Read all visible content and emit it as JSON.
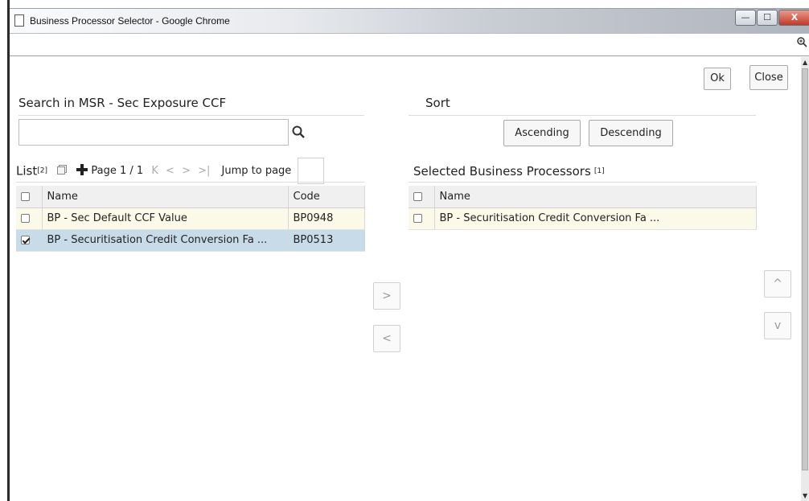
{
  "window": {
    "title": "Business Processor Selector - Google Chrome",
    "close_glyph": "X",
    "minimize_glyph": "—",
    "maximize_glyph": "☐"
  },
  "header_buttons": {
    "ok": "Ok",
    "close": "Close"
  },
  "search": {
    "label": "Search in MSR - Sec Exposure CCF",
    "value": "",
    "placeholder": ""
  },
  "sort": {
    "label": "Sort",
    "ascending": "Ascending",
    "descending": "Descending"
  },
  "list": {
    "label": "List",
    "count": "[2]",
    "page_label": "Page 1 / 1",
    "jump_label": "Jump to page",
    "nav": {
      "first": "K",
      "prev": "<",
      "next": ">",
      "last": ">|"
    },
    "columns": [
      "Name",
      "Code"
    ],
    "rows": [
      {
        "name": "BP - Sec Default CCF Value",
        "code": "BP0948",
        "checked": false
      },
      {
        "name": "BP - Securitisation Credit Conversion Fa ...",
        "code": "BP0513",
        "checked": true
      }
    ]
  },
  "selected": {
    "label": "Selected Business Processors",
    "count": "[1]",
    "columns": [
      "Name"
    ],
    "rows": [
      {
        "name": "BP - Securitisation Credit Conversion Fa ...",
        "checked": false
      }
    ]
  },
  "transfer": {
    "move_right": ">",
    "move_left": "<"
  },
  "reorder": {
    "up": "^",
    "down": "v"
  },
  "colors": {
    "selected_row": "#c8dbe8",
    "light_row": "#fbf9e8",
    "header_row": "#f0f0f0"
  }
}
